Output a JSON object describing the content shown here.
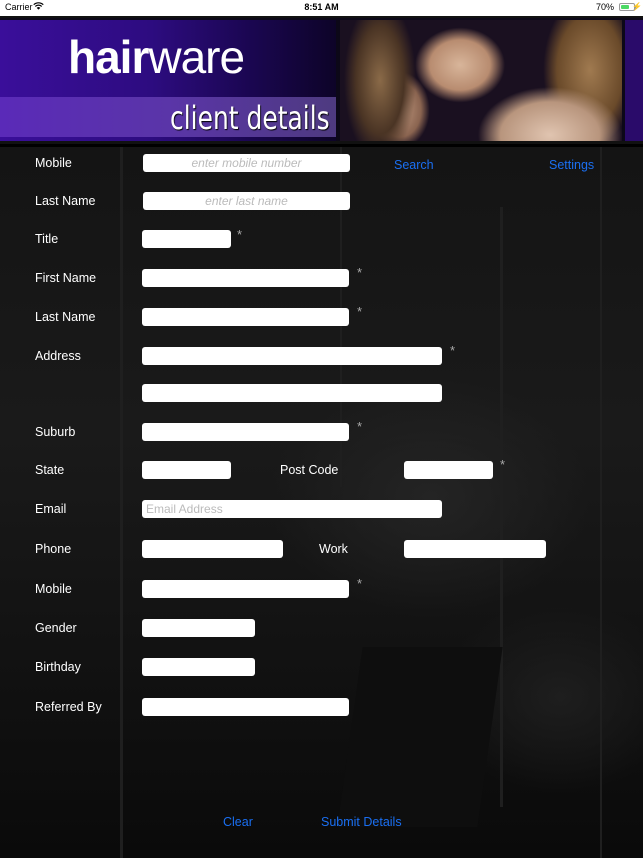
{
  "status_bar": {
    "carrier": "Carrier",
    "time": "8:51 AM",
    "battery_percent": "70%",
    "battery_level": 0.7,
    "icons": [
      "wifi-icon",
      "battery-icon",
      "charging-bolt-icon"
    ]
  },
  "header": {
    "logo_bold": "hair",
    "logo_light": "ware",
    "subtitle": "client details"
  },
  "search": {
    "mobile_label": "Mobile",
    "mobile_placeholder": "enter mobile number",
    "last_name_label": "Last Name",
    "last_name_placeholder": "enter last name",
    "search_button": "Search",
    "settings_button": "Settings"
  },
  "form": {
    "required_marker": "*",
    "title_label": "Title",
    "first_name_label": "First Name",
    "last_name_label": "Last Name",
    "address_label": "Address",
    "suburb_label": "Suburb",
    "state_label": "State",
    "post_code_label": "Post Code",
    "email_label": "Email",
    "email_placeholder": "Email Address",
    "phone_label": "Phone",
    "work_label": "Work",
    "mobile_label": "Mobile",
    "gender_label": "Gender",
    "birthday_label": "Birthday",
    "referred_by_label": "Referred By"
  },
  "actions": {
    "clear_button": "Clear",
    "submit_button": "Submit Details"
  },
  "colors": {
    "link": "#1a6ff2",
    "brand_purple": "#3a0e9a"
  }
}
